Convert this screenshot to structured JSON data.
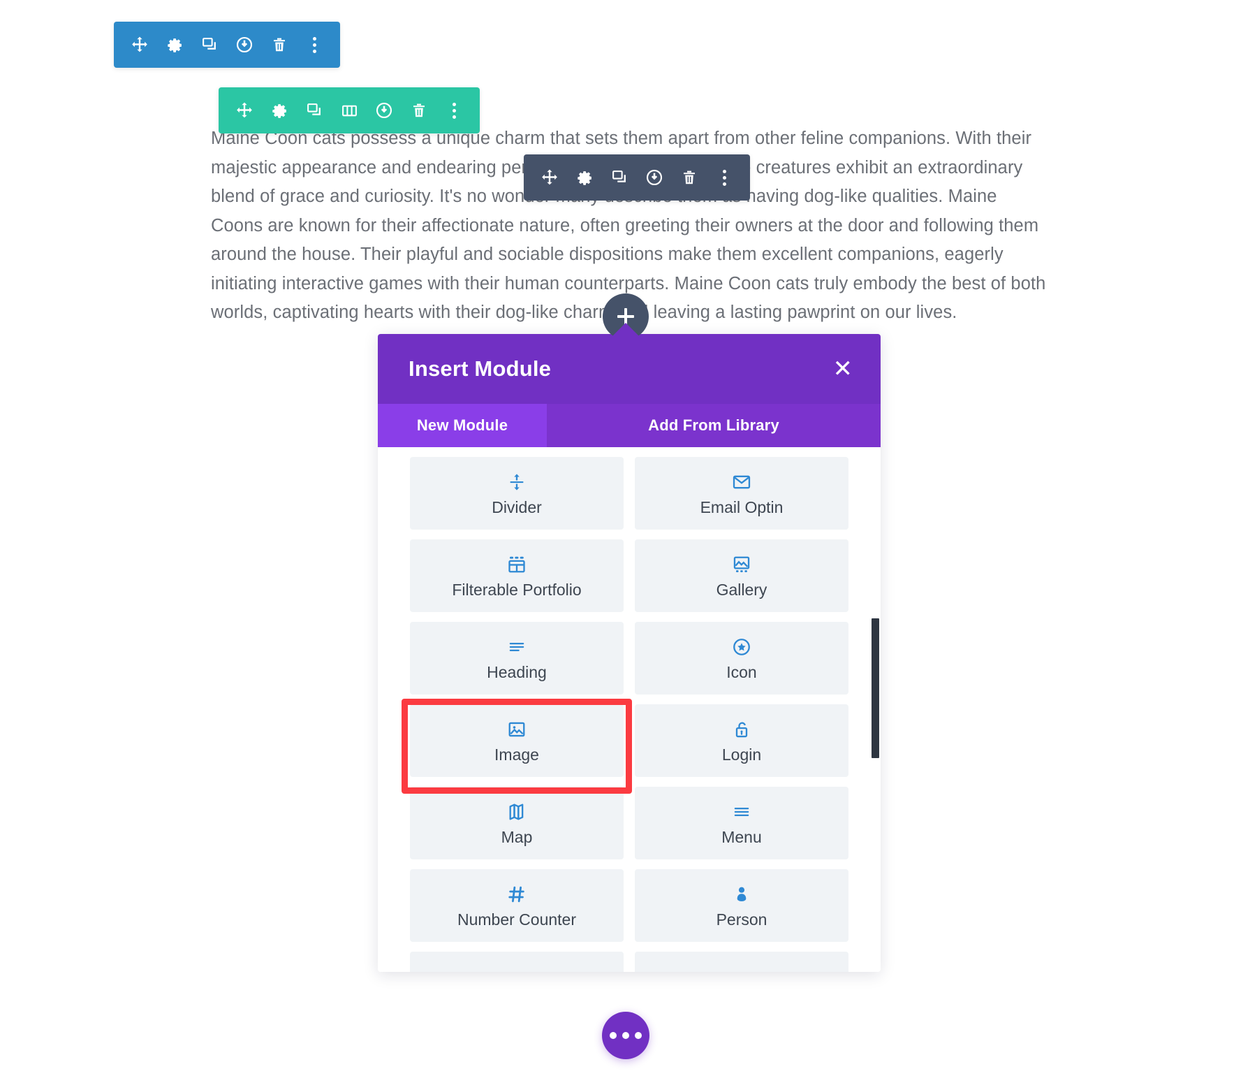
{
  "article": {
    "paragraph": "Maine Coon cats possess a unique charm that sets them apart from other feline companions. With their majestic appearance and endearing personalities, these remarkable creatures exhibit an extraordinary blend of grace and curiosity. It's no wonder many describe them as having dog-like qualities. Maine Coons are known for their affectionate nature, often greeting their owners at the door and following them around the house. Their playful and sociable dispositions make them excellent companions, eagerly initiating interactive games with their human counterparts. Maine Coon cats truly embody the best of both worlds, captivating hearts with their dog-like charm and leaving a lasting pawprint on our lives."
  },
  "toolbars": {
    "section": {
      "color": "#2d8ac9",
      "icons": [
        "move-icon",
        "gear-icon",
        "duplicate-icon",
        "power-icon",
        "trash-icon",
        "kebab-icon"
      ]
    },
    "row": {
      "color": "#2bc6a4",
      "icons": [
        "move-icon",
        "gear-icon",
        "duplicate-icon",
        "columns-icon",
        "power-icon",
        "trash-icon",
        "kebab-icon"
      ]
    },
    "module": {
      "color": "#455269",
      "icons": [
        "move-icon",
        "gear-icon",
        "duplicate-icon",
        "power-icon",
        "trash-icon",
        "kebab-icon"
      ]
    }
  },
  "insert_pin": {
    "icon": "plus-icon"
  },
  "modal": {
    "title": "Insert Module",
    "close_label": "✕",
    "tabs": [
      {
        "label": "New Module",
        "active": true
      },
      {
        "label": "Add From Library",
        "active": false
      }
    ],
    "modules": [
      {
        "label": "Divider",
        "icon": "divider-icon"
      },
      {
        "label": "Email Optin",
        "icon": "envelope-icon"
      },
      {
        "label": "Filterable Portfolio",
        "icon": "grid-icon"
      },
      {
        "label": "Gallery",
        "icon": "gallery-icon"
      },
      {
        "label": "Heading",
        "icon": "heading-lines-icon"
      },
      {
        "label": "Icon",
        "icon": "star-circle-icon"
      },
      {
        "label": "Image",
        "icon": "image-icon",
        "highlighted": true
      },
      {
        "label": "Login",
        "icon": "unlock-icon"
      },
      {
        "label": "Map",
        "icon": "map-icon"
      },
      {
        "label": "Menu",
        "icon": "menu-lines-icon"
      },
      {
        "label": "Number Counter",
        "icon": "hash-icon"
      },
      {
        "label": "Person",
        "icon": "person-icon"
      }
    ],
    "colors": {
      "header": "#7130c3",
      "tab_active": "#8a3ee8",
      "tab_bar": "#7b33cd",
      "card_bg": "#f0f3f6",
      "icon": "#2f89d4",
      "highlight": "#fb3b41"
    }
  },
  "fab": {
    "icon": "ellipsis-icon",
    "color": "#7130c3"
  }
}
